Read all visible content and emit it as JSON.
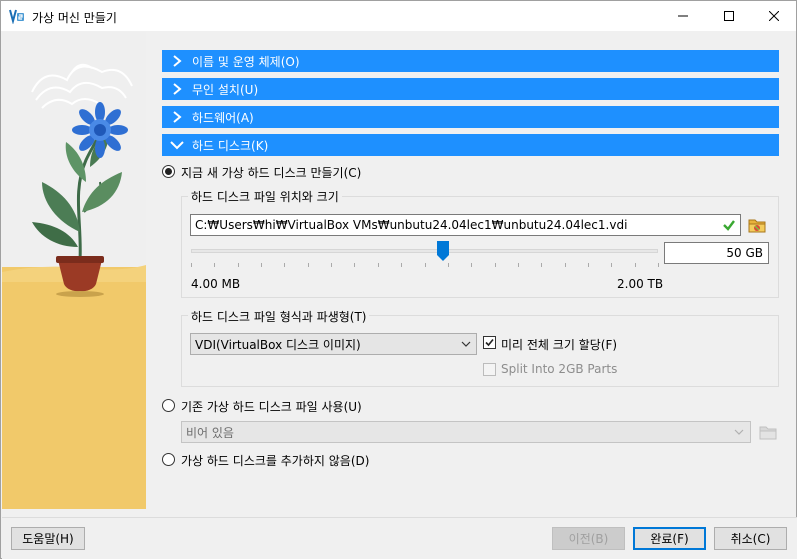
{
  "window": {
    "title": "가상 머신 만들기",
    "controls": {
      "minimize": "—",
      "maximize": "☐",
      "close": "✕"
    }
  },
  "sections": [
    {
      "label": "이름 및 운영 체제(O)",
      "expanded": false
    },
    {
      "label": "무인 설치(U)",
      "expanded": false
    },
    {
      "label": "하드웨어(A)",
      "expanded": false
    },
    {
      "label": "하드 디스크(K)",
      "expanded": true
    }
  ],
  "disk": {
    "create_new_label": "지금 새 가상 하드 디스크 만들기(C)",
    "location_group_title": "하드 디스크 파일 위치와 크기",
    "file_path": "C:₩Users₩hi₩VirtualBox VMs₩unbutu24.04lec1₩unbutu24.04lec1.vdi",
    "size_value": "50 GB",
    "size_min": "4.00 MB",
    "size_max": "2.00 TB",
    "size_fraction": 0.54,
    "format_group_title": "하드 디스크 파일 형식과 파생형(T)",
    "format_selected": "VDI(VirtualBox 디스크 이미지)",
    "preallocate_label": "미리 전체 크기 할당(F)",
    "preallocate_checked": true,
    "split_label": "Split Into 2GB Parts",
    "split_checked": false,
    "use_existing_label": "기존 가상 하드 디스크 파일 사용(U)",
    "existing_placeholder": "비어 있음",
    "no_disk_label": "가상 하드 디스크를 추가하지 않음(D)"
  },
  "buttons": {
    "help": "도움말(H)",
    "back": "이전(B)",
    "finish": "완료(F)",
    "cancel": "취소(C)"
  },
  "icons": [
    "virtualbox-app-icon",
    "chevron-right-icon",
    "chevron-down-icon",
    "checkmark-icon",
    "folder-icon"
  ],
  "colors": {
    "section_bar": "#1e90ff",
    "slider_handle": "#0078d7",
    "valid_check": "#3aa832"
  }
}
